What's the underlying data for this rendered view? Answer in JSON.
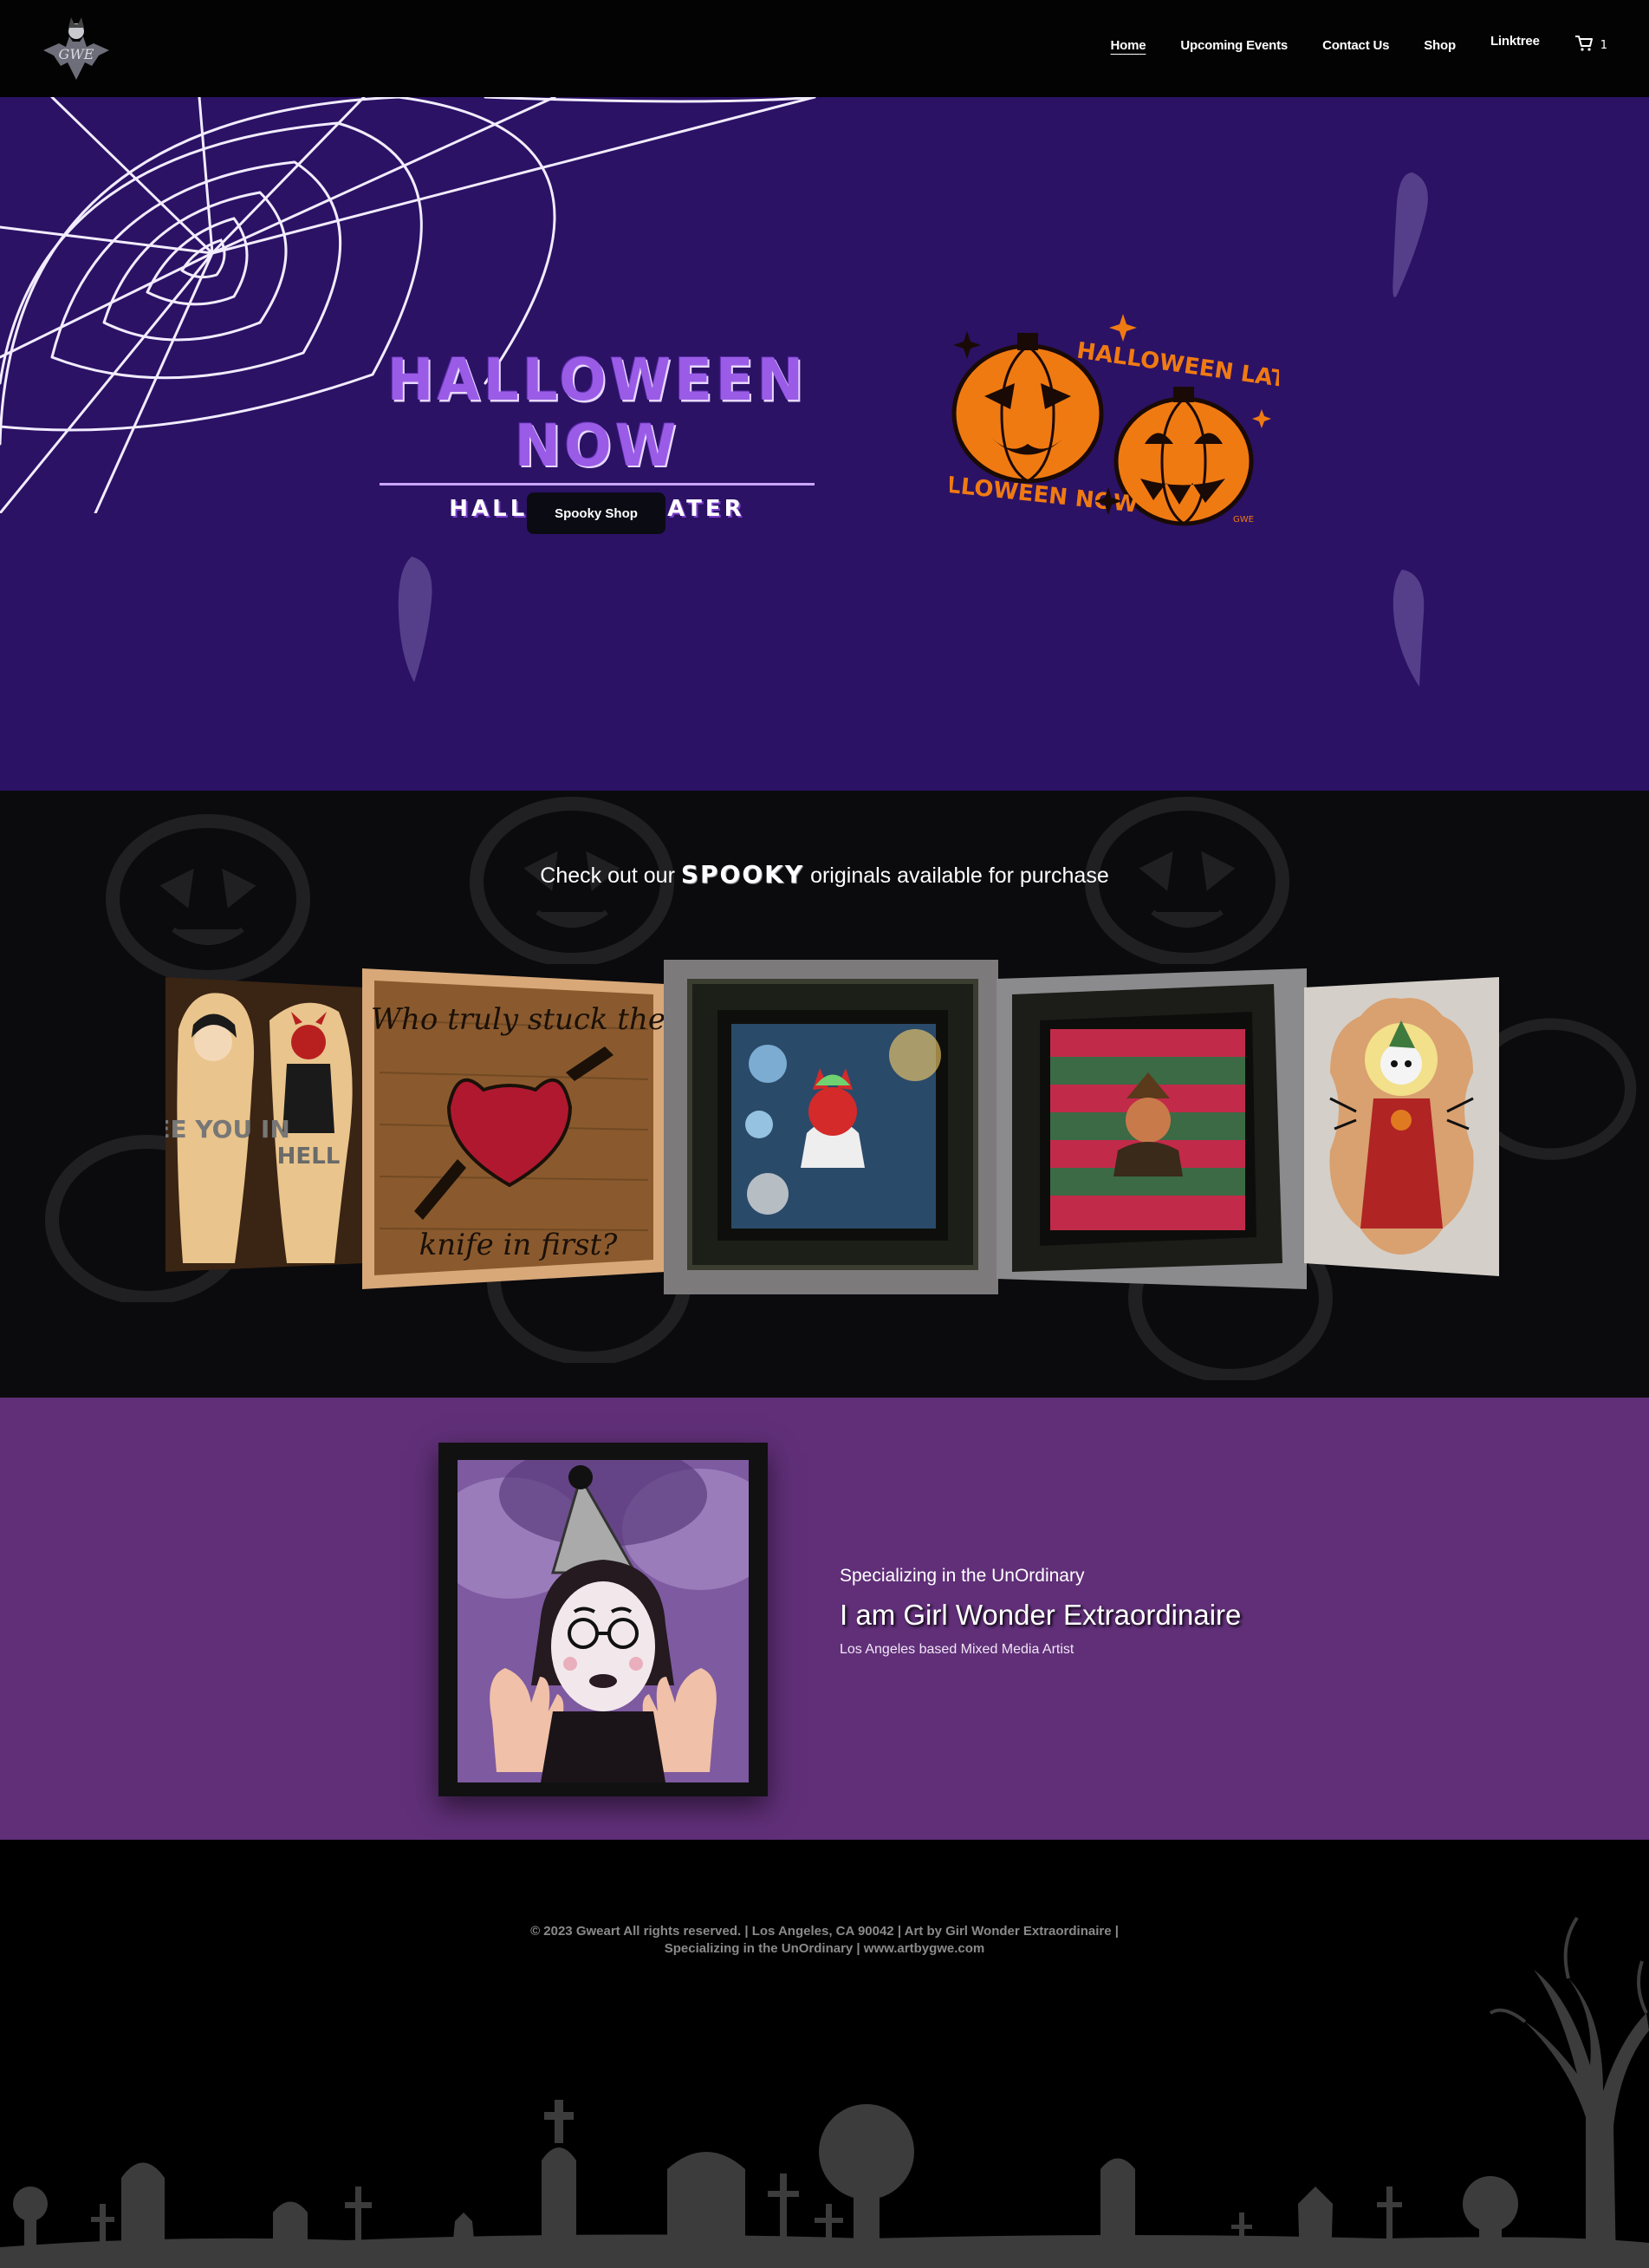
{
  "nav": {
    "items": [
      {
        "label": "Home",
        "active": true
      },
      {
        "label": "Upcoming Events"
      },
      {
        "label": "Contact Us"
      },
      {
        "label": "Shop"
      },
      {
        "label": "Linktree"
      }
    ],
    "cart_count": "1"
  },
  "logo": {
    "text": "GWE"
  },
  "hero": {
    "title": "HALLOWEEN NOW",
    "subtitle": "HALLOWEEN LATER",
    "button": "Spooky Shop",
    "badge_top": "HALLOWEEN LATER",
    "badge_bottom": "HALLOWEEN NOW",
    "badge_sign": "GWE"
  },
  "originals": {
    "heading_before": "Check out our",
    "heading_spooky": "SPOOKY",
    "heading_after": "originals available for purchase",
    "artworks": [
      {
        "text_left": "SEE YOU IN",
        "text_right": "HELL"
      },
      {
        "text_top": "Who truly stuck the",
        "text_bottom": "knife in first?"
      }
    ]
  },
  "about": {
    "kicker": "Specializing in the UnOrdinary",
    "title": "I am Girl Wonder Extraordinaire",
    "description": "Los Angeles based Mixed Media Artist"
  },
  "footer": {
    "line1": "© 2023 Gweart All rights reserved. | Los Angeles, CA 90042 | Art by Girl Wonder Extraordinaire |",
    "line2": "Specializing in the UnOrdinary | www.artbygwe.com"
  },
  "colors": {
    "hero_bg": "#2b1265",
    "about_bg": "#602f78",
    "pumpkin_orange": "#f07a12",
    "title_purple": "#9a5ce6"
  }
}
